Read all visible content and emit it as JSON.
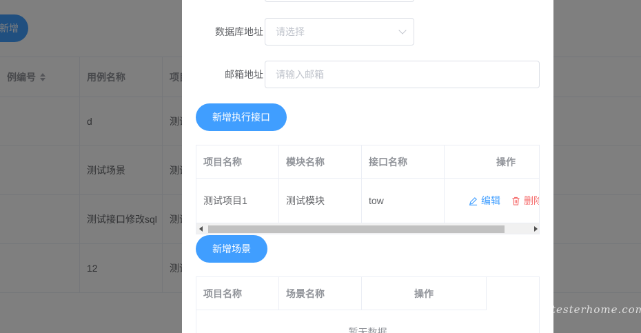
{
  "background": {
    "add_button": "新增",
    "columns": [
      "例编号",
      "用例名称",
      "项目"
    ],
    "rows": [
      {
        "name": "d",
        "project": "测试"
      },
      {
        "name": "测试场景",
        "project": "测试"
      },
      {
        "name": "测试接口修改sql",
        "project": "测试"
      },
      {
        "name": "12",
        "project": "测试"
      }
    ]
  },
  "form": {
    "database": {
      "label": "数据库地址",
      "placeholder": "请选择"
    },
    "email": {
      "label": "邮箱地址",
      "placeholder": "请输入邮箱"
    }
  },
  "interfaces": {
    "add_button": "新增执行接口",
    "columns": [
      "项目名称",
      "模块名称",
      "接口名称",
      "操作"
    ],
    "rows": [
      {
        "project": "测试项目1",
        "module": "测试模块",
        "api": "tow"
      }
    ],
    "edit_label": "编辑",
    "delete_label": "删除"
  },
  "scenes": {
    "add_button": "新增场景",
    "columns": [
      "项目名称",
      "场景名称",
      "操作"
    ],
    "empty_text": "暂无数据"
  },
  "watermark": "testerhome.com"
}
